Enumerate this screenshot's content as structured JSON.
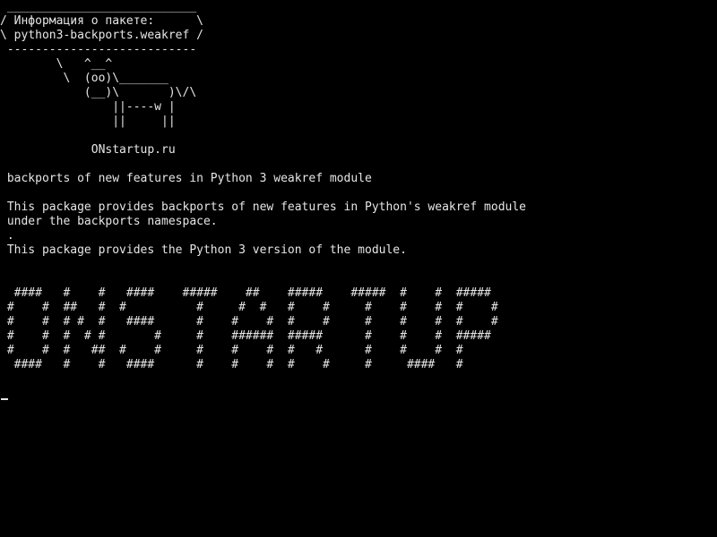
{
  "terminal": {
    "background": "#000000",
    "foreground": "#e6e6e6",
    "bubble": {
      "top_border": " ___________________________",
      "line1": "/ Информация о пакете:      \\",
      "line2": "\\ python3-backports.weakref /",
      "bottom_border": " ---------------------------"
    },
    "cow": [
      "        \\   ^__^",
      "         \\  (oo)\\_______",
      "            (__)\\       )\\/\\",
      "                ||----w |",
      "                ||     ||"
    ],
    "site": "             ONstartup.ru",
    "summary": " backports of new features in Python 3 weakref module",
    "description": [
      " This package provides backports of new features in Python's weakref module",
      " under the backports namespace.",
      " .",
      " This package provides the Python 3 version of the module."
    ],
    "banner": [
      "  ####   #    #   ####    #####    ##    #####    #####  #    #  #####",
      " #    #  ##   #  #          #     #  #   #    #     #    #    #  #    #",
      " #    #  # #  #   ####      #    #    #  #    #     #    #    #  #    #",
      " #    #  #  # #       #     #    ######  #####      #    #    #  #####",
      " #    #  #   ##  #    #     #    #    #  #   #      #    #    #  #",
      "  ####   #    #   ####      #    #    #  #    #     #     ####   #"
    ]
  }
}
